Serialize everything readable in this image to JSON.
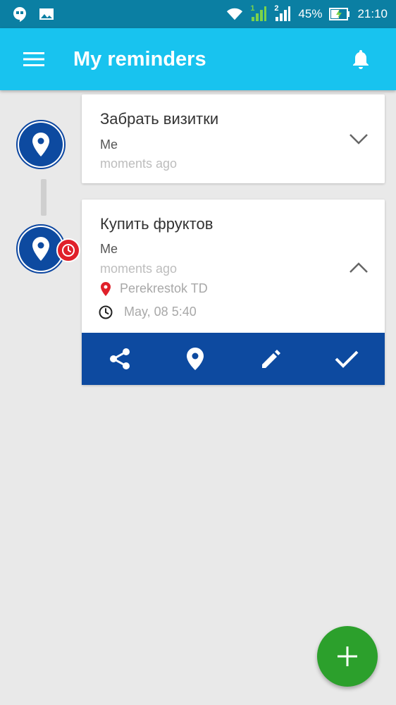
{
  "status_bar": {
    "battery": "45%",
    "time": "21:10",
    "icons": [
      "hangouts-icon",
      "gallery-icon",
      "wifi-icon",
      "signal-sim1-icon",
      "signal-sim2-icon",
      "battery-charging-icon"
    ],
    "sim1_label": "1",
    "sim2_label": "2"
  },
  "app_bar": {
    "title": "My reminders",
    "menu_icon": "hamburger-menu-icon",
    "bell_icon": "notifications-bell-icon"
  },
  "reminders": [
    {
      "title": "Забрать визитки",
      "user": "Me",
      "created": "moments ago",
      "expanded": false
    },
    {
      "title": "Купить фруктов",
      "user": "Me",
      "created": "moments ago",
      "expanded": true,
      "location": "Perekrestok TD",
      "datetime": "May, 08 5:40",
      "actions": [
        "share-icon",
        "location-pin-icon",
        "edit-pencil-icon",
        "check-icon"
      ]
    }
  ],
  "fab": {
    "icon": "plus-icon"
  },
  "colors": {
    "status_bar": "#0b7fa3",
    "app_bar": "#18c3ef",
    "accent_blue": "#0d4aa0",
    "alarm_red": "#e0202a",
    "fab_green": "#2ca02c",
    "background": "#e9e9e9"
  }
}
